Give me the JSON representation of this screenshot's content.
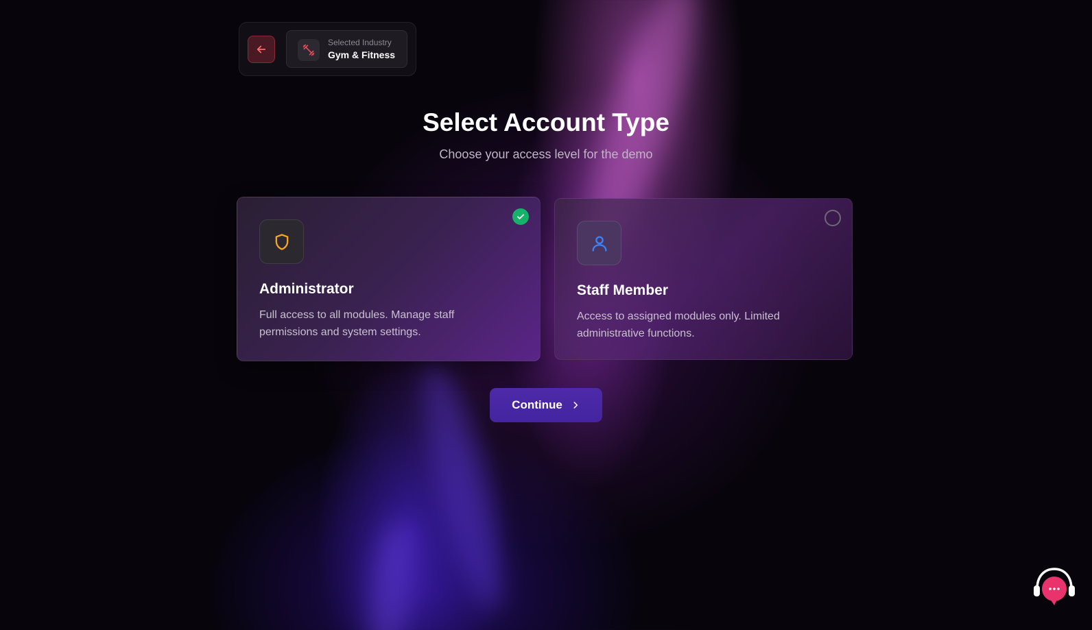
{
  "header": {
    "back_button_icon": "arrow-left-icon",
    "industry_caption": "Selected Industry",
    "industry_name": "Gym & Fitness",
    "industry_icon": "dumbbell-icon"
  },
  "page": {
    "title": "Select Account Type",
    "subtitle": "Choose your access level for the demo"
  },
  "account_types": [
    {
      "title": "Administrator",
      "description": "Full access to all modules. Manage staff permissions and system settings.",
      "icon": "shield-icon",
      "icon_color": "#f5a524",
      "selected": true
    },
    {
      "title": "Staff Member",
      "description": "Access to assigned modules only. Limited administrative functions.",
      "icon": "user-icon",
      "icon_color": "#3b82f6",
      "selected": false
    }
  ],
  "actions": {
    "continue_label": "Continue"
  },
  "support": {
    "icon": "headset-chat-icon",
    "color": "#e8336d"
  },
  "colors": {
    "selected_check": "#17b26a",
    "back_button": "#4a1a24",
    "continue_button": "#4d2aa8"
  }
}
